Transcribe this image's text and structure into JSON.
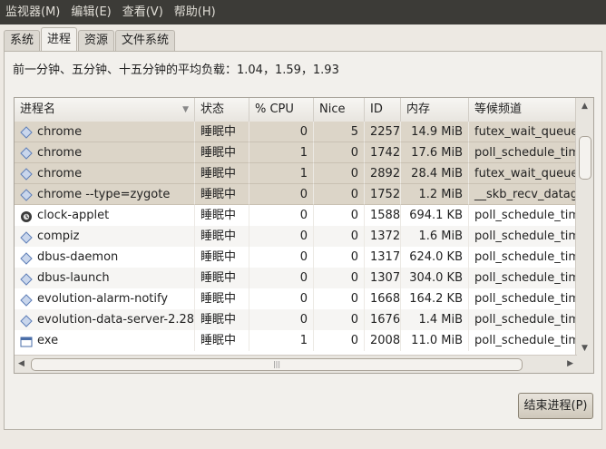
{
  "menubar": {
    "items": [
      "监视器(M)",
      "编辑(E)",
      "查看(V)",
      "帮助(H)"
    ]
  },
  "tabs": {
    "items": [
      "系统",
      "进程",
      "资源",
      "文件系统"
    ],
    "active": "进程"
  },
  "load_text": "前一分钟、五分钟、十五分钟的平均负载：1.04，1.59，1.93",
  "table": {
    "columns": [
      "进程名",
      "状态",
      "% CPU",
      "Nice",
      "ID",
      "内存",
      "等候频道"
    ],
    "rows": [
      {
        "name": "chrome",
        "status": "睡眠中",
        "cpu": "0",
        "nice": "5",
        "id": "2257",
        "mem": "14.9 MiB",
        "wchan": "futex_wait_queue",
        "icon": "diamond-icon",
        "selected": true
      },
      {
        "name": "chrome",
        "status": "睡眠中",
        "cpu": "1",
        "nice": "0",
        "id": "1742",
        "mem": "17.6 MiB",
        "wchan": "poll_schedule_timeout",
        "icon": "diamond-icon",
        "selected": true
      },
      {
        "name": "chrome",
        "status": "睡眠中",
        "cpu": "1",
        "nice": "0",
        "id": "2892",
        "mem": "28.4 MiB",
        "wchan": "futex_wait_queue",
        "icon": "diamond-icon",
        "selected": true
      },
      {
        "name": "chrome --type=zygote",
        "status": "睡眠中",
        "cpu": "0",
        "nice": "0",
        "id": "1752",
        "mem": "1.2 MiB",
        "wchan": "__skb_recv_datagram",
        "icon": "diamond-icon",
        "selected": true
      },
      {
        "name": "clock-applet",
        "status": "睡眠中",
        "cpu": "0",
        "nice": "0",
        "id": "1588",
        "mem": "694.1 KB",
        "wchan": "poll_schedule_timeout",
        "icon": "clock-icon",
        "selected": false
      },
      {
        "name": "compiz",
        "status": "睡眠中",
        "cpu": "0",
        "nice": "0",
        "id": "1372",
        "mem": "1.6 MiB",
        "wchan": "poll_schedule_timeout",
        "icon": "diamond-icon",
        "selected": false
      },
      {
        "name": "dbus-daemon",
        "status": "睡眠中",
        "cpu": "0",
        "nice": "0",
        "id": "1317",
        "mem": "624.0 KB",
        "wchan": "poll_schedule_timeout",
        "icon": "diamond-icon",
        "selected": false
      },
      {
        "name": "dbus-launch",
        "status": "睡眠中",
        "cpu": "0",
        "nice": "0",
        "id": "1307",
        "mem": "304.0 KB",
        "wchan": "poll_schedule_timeout",
        "icon": "diamond-icon",
        "selected": false
      },
      {
        "name": "evolution-alarm-notify",
        "status": "睡眠中",
        "cpu": "0",
        "nice": "0",
        "id": "1668",
        "mem": "164.2 KB",
        "wchan": "poll_schedule_timeout",
        "icon": "diamond-icon",
        "selected": false
      },
      {
        "name": "evolution-data-server-2.28",
        "status": "睡眠中",
        "cpu": "0",
        "nice": "0",
        "id": "1676",
        "mem": "1.4 MiB",
        "wchan": "poll_schedule_timeout",
        "icon": "diamond-icon",
        "selected": false
      },
      {
        "name": "exe",
        "status": "睡眠中",
        "cpu": "1",
        "nice": "0",
        "id": "2008",
        "mem": "11.0 MiB",
        "wchan": "poll_schedule_timeout",
        "icon": "window-icon",
        "selected": false
      }
    ]
  },
  "end_process_button": "结束进程(P)",
  "colors": {
    "menubar_bg": "#3c3b37",
    "selected_row": "#dcd5c8",
    "window_bg": "#ede9e3"
  }
}
